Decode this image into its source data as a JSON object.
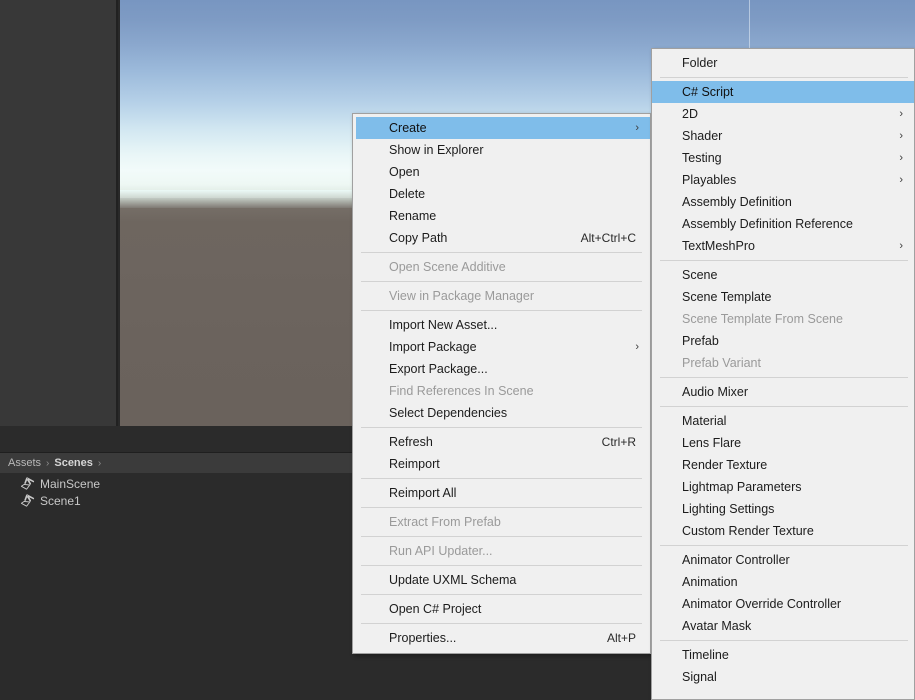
{
  "scene_view": {
    "sky_top_color": "#7896c1",
    "sky_horizon_color": "#f2fbfa",
    "ground_color": "#6b635d",
    "light_gizmo_name": "directional-light-gizmo"
  },
  "project_window": {
    "breadcrumb": [
      {
        "label": "Assets",
        "current": false
      },
      {
        "label": "Scenes",
        "current": true
      }
    ],
    "breadcrumb_separator": "›",
    "assets": [
      {
        "label": "MainScene",
        "icon": "unity-scene-icon"
      },
      {
        "label": "Scene1",
        "icon": "unity-scene-icon"
      }
    ]
  },
  "context_menu_assets": {
    "name": "assets-context-menu",
    "items": [
      {
        "label": "Create",
        "shortcut": "",
        "submenu": true,
        "disabled": false,
        "highlighted": true
      },
      {
        "label": "Show in Explorer",
        "shortcut": "",
        "submenu": false,
        "disabled": false,
        "highlighted": false
      },
      {
        "label": "Open",
        "shortcut": "",
        "submenu": false,
        "disabled": false,
        "highlighted": false
      },
      {
        "label": "Delete",
        "shortcut": "",
        "submenu": false,
        "disabled": false,
        "highlighted": false
      },
      {
        "label": "Rename",
        "shortcut": "",
        "submenu": false,
        "disabled": false,
        "highlighted": false
      },
      {
        "label": "Copy Path",
        "shortcut": "Alt+Ctrl+C",
        "submenu": false,
        "disabled": false,
        "highlighted": false
      },
      {
        "separator": true
      },
      {
        "label": "Open Scene Additive",
        "shortcut": "",
        "submenu": false,
        "disabled": true,
        "highlighted": false
      },
      {
        "separator": true
      },
      {
        "label": "View in Package Manager",
        "shortcut": "",
        "submenu": false,
        "disabled": true,
        "highlighted": false
      },
      {
        "separator": true
      },
      {
        "label": "Import New Asset...",
        "shortcut": "",
        "submenu": false,
        "disabled": false,
        "highlighted": false
      },
      {
        "label": "Import Package",
        "shortcut": "",
        "submenu": true,
        "disabled": false,
        "highlighted": false
      },
      {
        "label": "Export Package...",
        "shortcut": "",
        "submenu": false,
        "disabled": false,
        "highlighted": false
      },
      {
        "label": "Find References In Scene",
        "shortcut": "",
        "submenu": false,
        "disabled": true,
        "highlighted": false
      },
      {
        "label": "Select Dependencies",
        "shortcut": "",
        "submenu": false,
        "disabled": false,
        "highlighted": false
      },
      {
        "separator": true
      },
      {
        "label": "Refresh",
        "shortcut": "Ctrl+R",
        "submenu": false,
        "disabled": false,
        "highlighted": false
      },
      {
        "label": "Reimport",
        "shortcut": "",
        "submenu": false,
        "disabled": false,
        "highlighted": false
      },
      {
        "separator": true
      },
      {
        "label": "Reimport All",
        "shortcut": "",
        "submenu": false,
        "disabled": false,
        "highlighted": false
      },
      {
        "separator": true
      },
      {
        "label": "Extract From Prefab",
        "shortcut": "",
        "submenu": false,
        "disabled": true,
        "highlighted": false
      },
      {
        "separator": true
      },
      {
        "label": "Run API Updater...",
        "shortcut": "",
        "submenu": false,
        "disabled": true,
        "highlighted": false
      },
      {
        "separator": true
      },
      {
        "label": "Update UXML Schema",
        "shortcut": "",
        "submenu": false,
        "disabled": false,
        "highlighted": false
      },
      {
        "separator": true
      },
      {
        "label": "Open C# Project",
        "shortcut": "",
        "submenu": false,
        "disabled": false,
        "highlighted": false
      },
      {
        "separator": true
      },
      {
        "label": "Properties...",
        "shortcut": "Alt+P",
        "submenu": false,
        "disabled": false,
        "highlighted": false
      }
    ]
  },
  "context_menu_create": {
    "name": "create-submenu",
    "items": [
      {
        "label": "Folder",
        "submenu": false,
        "disabled": false,
        "highlighted": false
      },
      {
        "separator": true
      },
      {
        "label": "C# Script",
        "submenu": false,
        "disabled": false,
        "highlighted": true
      },
      {
        "label": "2D",
        "submenu": true,
        "disabled": false,
        "highlighted": false
      },
      {
        "label": "Shader",
        "submenu": true,
        "disabled": false,
        "highlighted": false
      },
      {
        "label": "Testing",
        "submenu": true,
        "disabled": false,
        "highlighted": false
      },
      {
        "label": "Playables",
        "submenu": true,
        "disabled": false,
        "highlighted": false
      },
      {
        "label": "Assembly Definition",
        "submenu": false,
        "disabled": false,
        "highlighted": false
      },
      {
        "label": "Assembly Definition Reference",
        "submenu": false,
        "disabled": false,
        "highlighted": false
      },
      {
        "label": "TextMeshPro",
        "submenu": true,
        "disabled": false,
        "highlighted": false
      },
      {
        "separator": true
      },
      {
        "label": "Scene",
        "submenu": false,
        "disabled": false,
        "highlighted": false
      },
      {
        "label": "Scene Template",
        "submenu": false,
        "disabled": false,
        "highlighted": false
      },
      {
        "label": "Scene Template From Scene",
        "submenu": false,
        "disabled": true,
        "highlighted": false
      },
      {
        "label": "Prefab",
        "submenu": false,
        "disabled": false,
        "highlighted": false
      },
      {
        "label": "Prefab Variant",
        "submenu": false,
        "disabled": true,
        "highlighted": false
      },
      {
        "separator": true
      },
      {
        "label": "Audio Mixer",
        "submenu": false,
        "disabled": false,
        "highlighted": false
      },
      {
        "separator": true
      },
      {
        "label": "Material",
        "submenu": false,
        "disabled": false,
        "highlighted": false
      },
      {
        "label": "Lens Flare",
        "submenu": false,
        "disabled": false,
        "highlighted": false
      },
      {
        "label": "Render Texture",
        "submenu": false,
        "disabled": false,
        "highlighted": false
      },
      {
        "label": "Lightmap Parameters",
        "submenu": false,
        "disabled": false,
        "highlighted": false
      },
      {
        "label": "Lighting Settings",
        "submenu": false,
        "disabled": false,
        "highlighted": false
      },
      {
        "label": "Custom Render Texture",
        "submenu": false,
        "disabled": false,
        "highlighted": false
      },
      {
        "separator": true
      },
      {
        "label": "Animator Controller",
        "submenu": false,
        "disabled": false,
        "highlighted": false
      },
      {
        "label": "Animation",
        "submenu": false,
        "disabled": false,
        "highlighted": false
      },
      {
        "label": "Animator Override Controller",
        "submenu": false,
        "disabled": false,
        "highlighted": false
      },
      {
        "label": "Avatar Mask",
        "submenu": false,
        "disabled": false,
        "highlighted": false
      },
      {
        "separator": true
      },
      {
        "label": "Timeline",
        "submenu": false,
        "disabled": false,
        "highlighted": false
      },
      {
        "label": "Signal",
        "submenu": false,
        "disabled": false,
        "highlighted": false
      }
    ]
  },
  "icons": {
    "submenu_arrow": "›"
  },
  "colors": {
    "menu_background": "#f0f0f0",
    "menu_highlight": "#7fbdea",
    "menu_disabled_text": "#9a9a9a",
    "editor_panel": "#383838",
    "editor_dark": "#2b2b2b"
  }
}
